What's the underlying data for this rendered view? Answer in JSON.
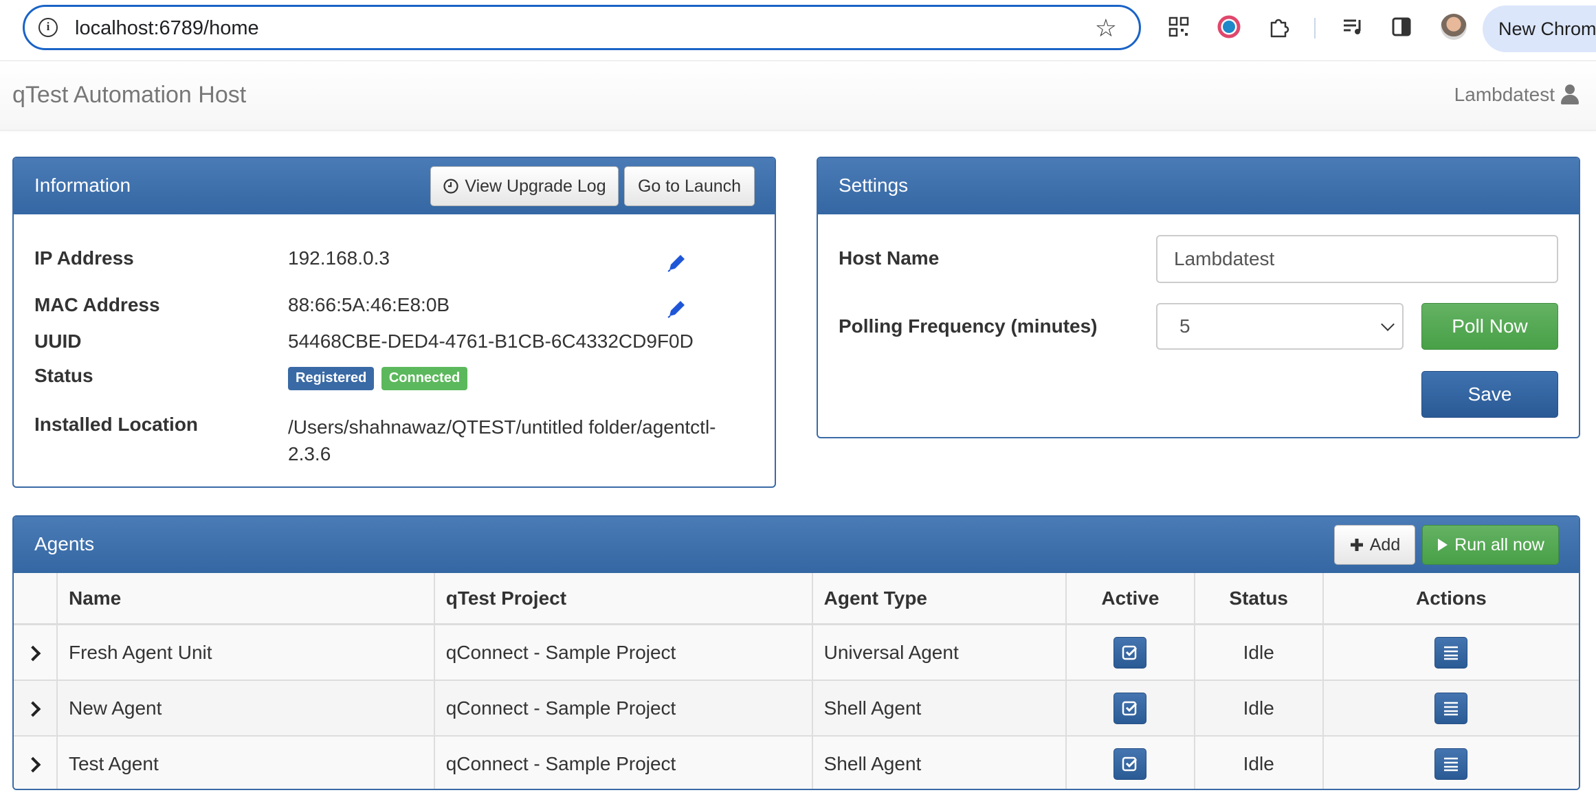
{
  "browser": {
    "url": "localhost:6789/home",
    "new_chrome_label": "New Chrome"
  },
  "navbar": {
    "brand": "qTest Automation Host",
    "user": "Lambdatest"
  },
  "information": {
    "title": "Information",
    "view_upgrade_log": "View Upgrade Log",
    "go_to_launch": "Go to Launch",
    "ip_label": "IP Address",
    "ip_value": "192.168.0.3",
    "mac_label": "MAC Address",
    "mac_value": "88:66:5A:46:E8:0B",
    "uuid_label": "UUID",
    "uuid_value": "54468CBE-DED4-4761-B1CB-6C4332CD9F0D",
    "status_label": "Status",
    "status_registered": "Registered",
    "status_connected": "Connected",
    "location_label": "Installed Location",
    "location_line1": "/Users/shahnawaz/QTEST/untitled folder/agentctl-",
    "location_line2": "2.3.6"
  },
  "settings": {
    "title": "Settings",
    "host_label": "Host Name",
    "host_value": "Lambdatest",
    "polling_label": "Polling Frequency (minutes)",
    "polling_value": "5",
    "poll_now": "Poll Now",
    "save": "Save"
  },
  "agents": {
    "title": "Agents",
    "add": "Add",
    "run_all": "Run all now",
    "columns": [
      "Name",
      "qTest Project",
      "Agent Type",
      "Active",
      "Status",
      "Actions"
    ],
    "rows": [
      {
        "name": "Fresh Agent Unit",
        "project": "qConnect - Sample Project",
        "type": "Universal Agent",
        "status": "Idle"
      },
      {
        "name": "New Agent",
        "project": "qConnect - Sample Project",
        "type": "Shell Agent",
        "status": "Idle"
      },
      {
        "name": "Test Agent",
        "project": "qConnect - Sample Project",
        "type": "Shell Agent",
        "status": "Idle"
      }
    ]
  },
  "colors": {
    "panel_header": "#3a6aa5",
    "success": "#5cb85c",
    "primary": "#2e5f9a",
    "badge_registered": "#3a6aa5",
    "badge_connected": "#5cb85c"
  }
}
